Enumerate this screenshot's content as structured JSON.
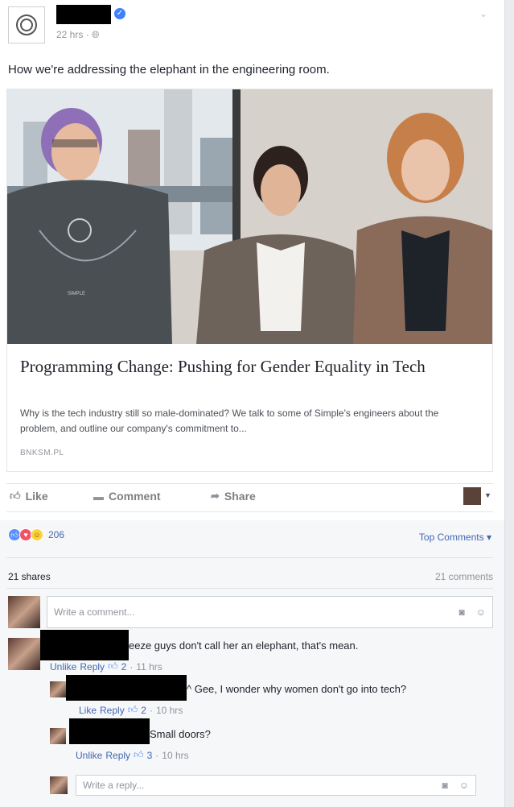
{
  "post": {
    "timestamp": "22 hrs",
    "text": "How we're addressing the elephant in the engineering room."
  },
  "link": {
    "title": "Programming Change: Pushing for Gender Equality in Tech",
    "description": "Why is the tech industry still so male-dominated? We talk to some of Simple's engineers about the problem, and outline our company's commitment to...",
    "domain": "BNKSM.PL",
    "shirt_text": "SIMPLE"
  },
  "actions": {
    "like": "Like",
    "comment": "Comment",
    "share": "Share"
  },
  "stats": {
    "reaction_count": "206",
    "top_comments": "Top Comments",
    "shares": "21 shares",
    "comments": "21 comments"
  },
  "comment_box": {
    "placeholder": "Write a comment..."
  },
  "comments": [
    {
      "text": "eeze guys don't call her an elephant, that's mean.",
      "like_action": "Unlike",
      "reply": "Reply",
      "likes": "2",
      "time": "11 hrs",
      "replies": [
        {
          "text": "^ Gee, I wonder why women don't go into tech?",
          "like_action": "Like",
          "reply": "Reply",
          "likes": "2",
          "time": "10 hrs"
        },
        {
          "text": "Small doors?",
          "like_action": "Unlike",
          "reply": "Reply",
          "likes": "3",
          "time": "10 hrs"
        }
      ]
    }
  ],
  "reply_box": {
    "placeholder": "Write a reply..."
  },
  "colors": {
    "link_blue": "#4267b2",
    "muted": "#90949c",
    "accent": "#4080ff"
  }
}
